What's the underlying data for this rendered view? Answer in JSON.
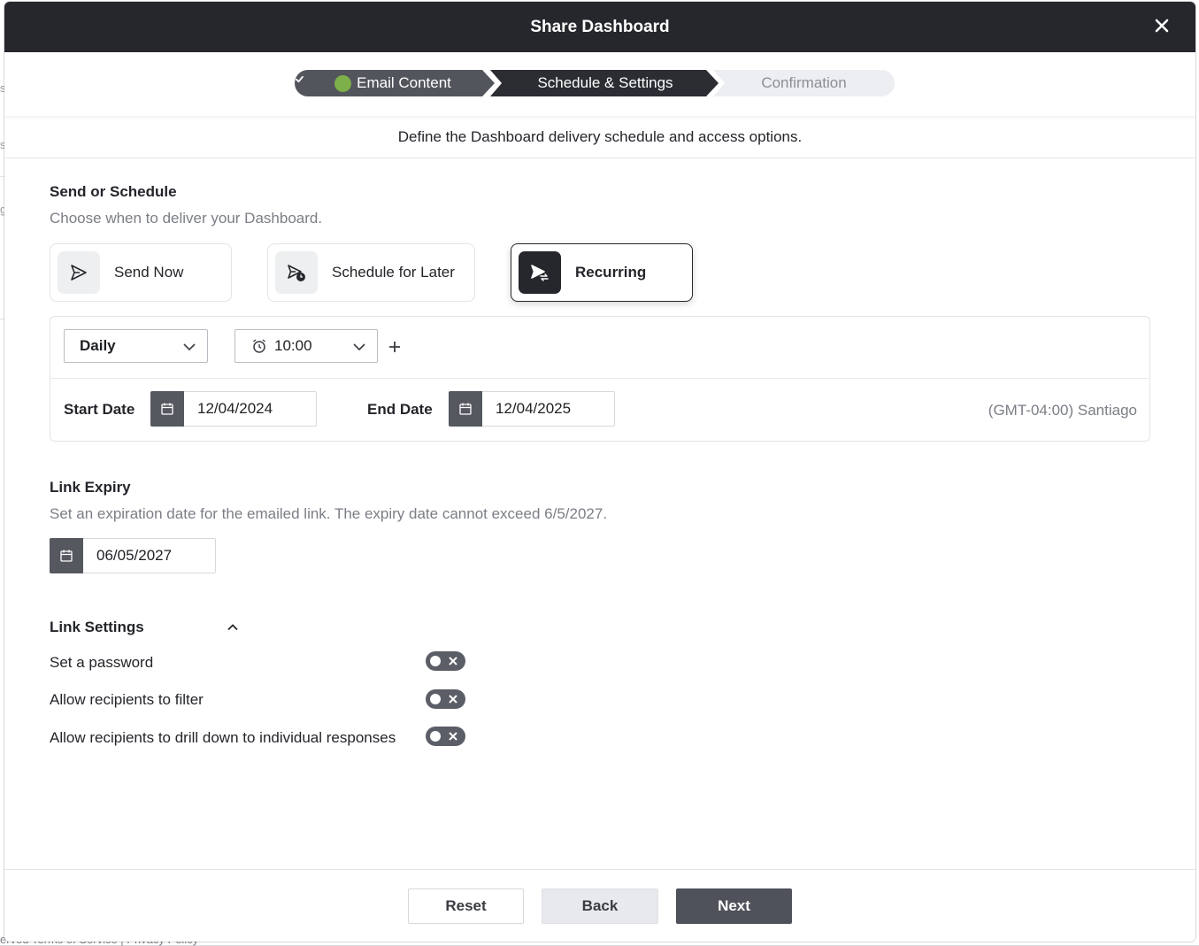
{
  "modal": {
    "title": "Share Dashboard",
    "subtitle": "Define the Dashboard delivery schedule and access options."
  },
  "steps": [
    {
      "label": "Email Content",
      "state": "complete"
    },
    {
      "label": "Schedule & Settings",
      "state": "active"
    },
    {
      "label": "Confirmation",
      "state": "pending"
    }
  ],
  "send_section": {
    "title": "Send or Schedule",
    "description": "Choose when to deliver your Dashboard.",
    "options": [
      {
        "label": "Send Now",
        "icon": "send-icon",
        "selected": false
      },
      {
        "label": "Schedule for Later",
        "icon": "schedule-send-icon",
        "selected": false
      },
      {
        "label": "Recurring",
        "icon": "recurring-send-icon",
        "selected": true
      }
    ]
  },
  "schedule": {
    "frequency": "Daily",
    "time": "10:00",
    "start_label": "Start Date",
    "start_date": "12/04/2024",
    "end_label": "End Date",
    "end_date": "12/04/2025",
    "timezone": "(GMT-04:00) Santiago"
  },
  "link_expiry": {
    "title": "Link Expiry",
    "description": "Set an expiration date for the emailed link. The expiry date cannot exceed 6/5/2027.",
    "date": "06/05/2027"
  },
  "link_settings": {
    "title": "Link Settings",
    "items": [
      {
        "label": "Set a password",
        "enabled": false
      },
      {
        "label": "Allow recipients to filter",
        "enabled": false
      },
      {
        "label": "Allow recipients to drill down to individual responses",
        "enabled": false
      }
    ]
  },
  "footer": {
    "reset": "Reset",
    "back": "Back",
    "next": "Next"
  },
  "background": {
    "footer_text": "erved    Terms of Service | Privacy Policy"
  },
  "colors": {
    "header_bg": "#25272c",
    "step_complete": "#52555c",
    "step_active": "#2b2d33",
    "step_pending": "#eceef1",
    "check_green": "#7db04a",
    "primary_button": "#4f525a"
  }
}
